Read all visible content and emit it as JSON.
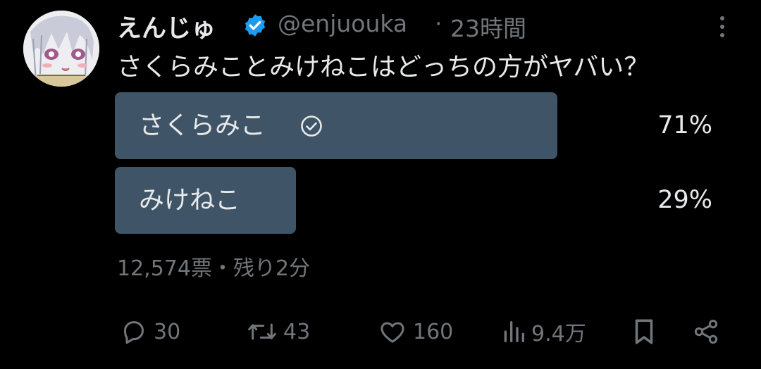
{
  "author": {
    "display_name": "えんじゅ",
    "handle": "@enjuouka",
    "separator": "·",
    "time": "23時間",
    "verified": true
  },
  "tweet": {
    "text": "さくらみことみけねこはどっちの方がヤバい？"
  },
  "poll": {
    "options": [
      {
        "label": "さくらみこ",
        "percent_text": "71%",
        "percent": 71,
        "selected": true
      },
      {
        "label": "みけねこ",
        "percent_text": "29%",
        "percent": 29,
        "selected": false
      }
    ],
    "meta": "12,574票・残り2分"
  },
  "actions": {
    "replies": "30",
    "retweets": "43",
    "likes": "160",
    "views": "9.4万"
  },
  "colors": {
    "background": "#000000",
    "text": "#e7e9ea",
    "muted": "#71767b",
    "poll_bar": "#3f5466",
    "verified": "#1d9bf0"
  },
  "icons": [
    "verified-badge-icon",
    "more-icon",
    "check-circle-icon",
    "reply-icon",
    "retweet-icon",
    "like-icon",
    "views-icon",
    "bookmark-icon",
    "share-icon"
  ]
}
